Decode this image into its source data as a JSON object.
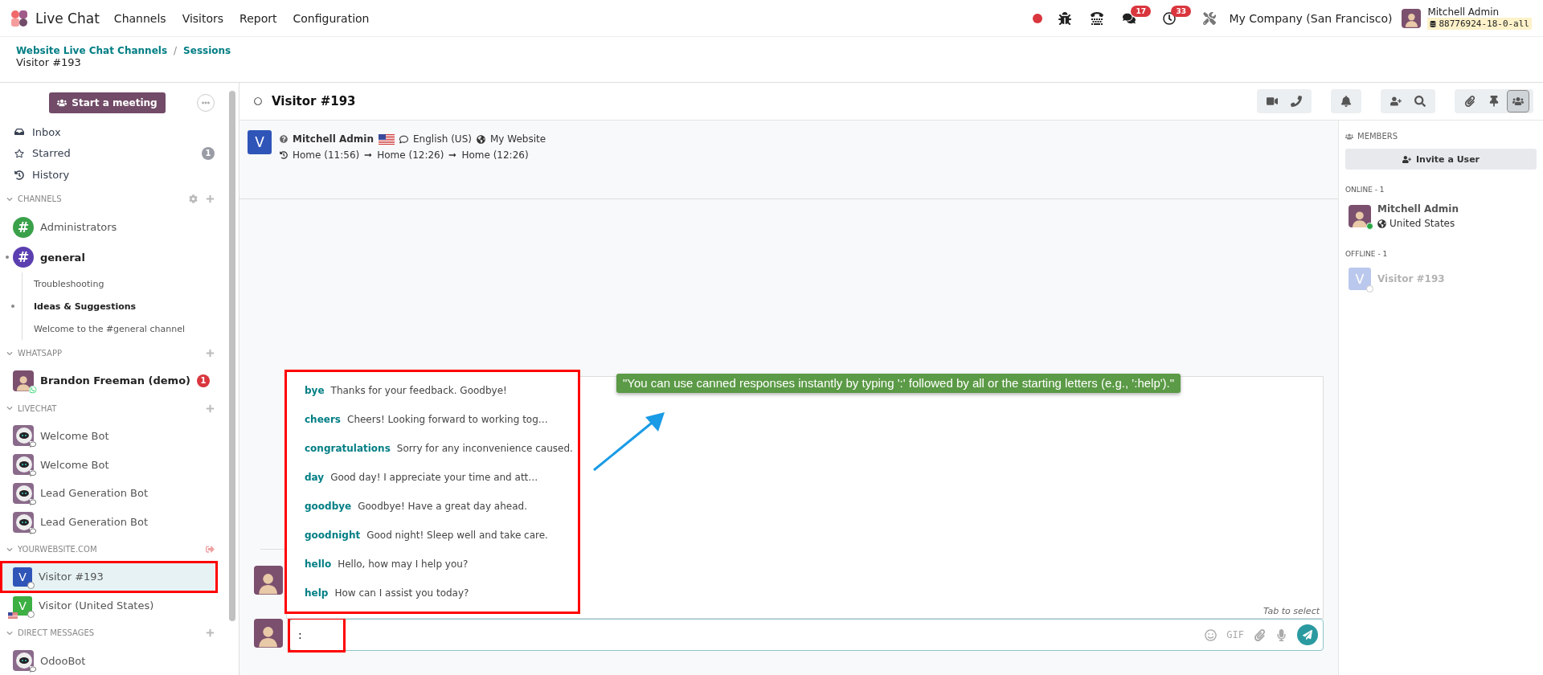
{
  "navbar": {
    "app_name": "Live Chat",
    "menu": [
      "Channels",
      "Visitors",
      "Report",
      "Configuration"
    ],
    "chat_badge": "17",
    "activity_badge": "33",
    "company": "My Company (San Francisco)",
    "user": {
      "name": "Mitchell Admin",
      "database": "88776924-18-0-all"
    }
  },
  "breadcrumb": {
    "items": [
      "Website Live Chat Channels",
      "Sessions"
    ],
    "separator": "/",
    "current": "Visitor #193"
  },
  "sidebar": {
    "meeting_button": "Start a meeting",
    "mailboxes": [
      {
        "kind": "inbox",
        "label": "Inbox"
      },
      {
        "kind": "starred",
        "label": "Starred",
        "count": "1"
      },
      {
        "kind": "history",
        "label": "History"
      }
    ],
    "categories": [
      {
        "title": "CHANNELS",
        "settings": true,
        "leave": false,
        "items": [
          {
            "kind": "channel",
            "symbol": "#",
            "name": "Administrators",
            "color": "#3aa14a",
            "unread": false,
            "selected": false,
            "highlighted": false
          },
          {
            "kind": "channel",
            "symbol": "#",
            "name": "general",
            "color": "#5b3fb1",
            "unread": true,
            "selected": false,
            "highlighted": false,
            "children": [
              {
                "name": "Troubleshooting",
                "unread": false
              },
              {
                "name": "Ideas & Suggestions",
                "unread": true
              },
              {
                "name": "Welcome to the #general channel",
                "unread": false
              }
            ]
          }
        ]
      },
      {
        "title": "WHATSAPP",
        "settings": false,
        "leave": false,
        "items": [
          {
            "kind": "person",
            "name": "Brandon Freeman (demo)",
            "unread": true,
            "count": "1",
            "selected": false,
            "highlighted": false
          }
        ]
      },
      {
        "title": "LIVECHAT",
        "settings": false,
        "leave": false,
        "items": [
          {
            "kind": "bot",
            "name": "Welcome Bot",
            "unread": false,
            "selected": false,
            "highlighted": false
          },
          {
            "kind": "bot",
            "name": "Welcome Bot",
            "unread": false,
            "selected": false,
            "highlighted": false
          },
          {
            "kind": "bot",
            "name": "Lead Generation Bot",
            "unread": false,
            "selected": false,
            "highlighted": false
          },
          {
            "kind": "bot",
            "name": "Lead Generation Bot",
            "unread": false,
            "selected": false,
            "highlighted": false
          }
        ]
      },
      {
        "title": "YOURWEBSITE.COM",
        "settings": false,
        "leave": true,
        "items": [
          {
            "kind": "visitor",
            "name": "Visitor #193",
            "initial": "V",
            "color": "#2f55b8",
            "flag": false,
            "unread": false,
            "selected": true,
            "highlighted": true
          },
          {
            "kind": "visitor",
            "name": "Visitor (United States)",
            "initial": "V",
            "color": "#3cb043",
            "flag": true,
            "unread": false,
            "selected": false,
            "highlighted": false
          }
        ]
      },
      {
        "title": "DIRECT MESSAGES",
        "settings": false,
        "leave": false,
        "items": [
          {
            "kind": "bot",
            "name": "OdooBot",
            "unread": false,
            "selected": false,
            "highlighted": false
          }
        ]
      }
    ]
  },
  "chat": {
    "title": "Visitor #193",
    "visitor": {
      "initial": "V",
      "name": "Mitchell Admin",
      "language": "English (US)",
      "website": "My Website",
      "history": [
        "Home (11:56)",
        "Home (12:26)",
        "Home (12:26)"
      ]
    },
    "suggestions": {
      "highlighted": true,
      "hint": "Tab to select",
      "items": [
        {
          "shortcut": "bye",
          "text": "Thanks for your feedback. Goodbye!"
        },
        {
          "shortcut": "cheers",
          "text": "Cheers! Looking forward to working tog…"
        },
        {
          "shortcut": "congratulations",
          "text": "Sorry for any inconvenience caused."
        },
        {
          "shortcut": "day",
          "text": "Good day! I appreciate your time and att…"
        },
        {
          "shortcut": "goodbye",
          "text": "Goodbye! Have a great day ahead."
        },
        {
          "shortcut": "goodnight",
          "text": "Good night! Sleep well and take care."
        },
        {
          "shortcut": "hello",
          "text": "Hello, how may I help you?"
        },
        {
          "shortcut": "help",
          "text": "How can I assist you today?"
        }
      ]
    },
    "callout": "\"You can use canned responses instantly by typing ':' followed by all or the starting letters (e.g., ':help').\"",
    "composer": {
      "value": ":",
      "highlighted": true,
      "gif": "GIF"
    }
  },
  "members": {
    "title": "MEMBERS",
    "invite_button": "Invite a User",
    "groups": [
      {
        "title": "ONLINE - 1",
        "members": [
          {
            "name": "Mitchell Admin",
            "location": "United States",
            "online": true
          }
        ]
      },
      {
        "title": "OFFLINE - 1",
        "members": [
          {
            "name": "Visitor #193",
            "initial": "V",
            "online": false
          }
        ]
      }
    ]
  }
}
